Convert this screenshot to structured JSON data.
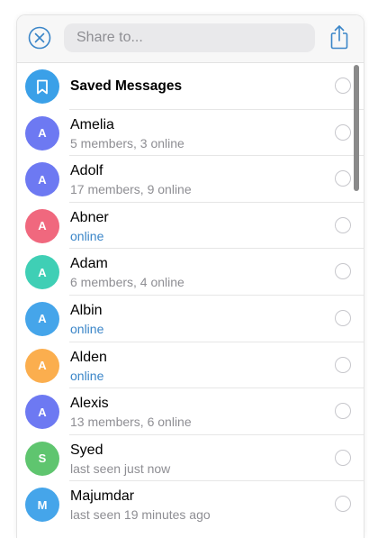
{
  "search": {
    "placeholder": "Share to..."
  },
  "icons": {
    "close": "close-circle-icon",
    "share": "share-icon",
    "saved": "bookmark-icon"
  },
  "colors": {
    "accent": "#3a85c8",
    "online": "#3a85c8"
  },
  "contacts": [
    {
      "name": "Saved Messages",
      "subtitle": "",
      "avatar_letter": "",
      "avatar_color": "#3aa0e8",
      "online": false,
      "saved": true
    },
    {
      "name": "Amelia",
      "subtitle": "5 members, 3 online",
      "avatar_letter": "A",
      "avatar_color": "#6d79f2",
      "online": false
    },
    {
      "name": "Adolf",
      "subtitle": "17 members, 9 online",
      "avatar_letter": "A",
      "avatar_color": "#6d79f2",
      "online": false
    },
    {
      "name": "Abner",
      "subtitle": "online",
      "avatar_letter": "A",
      "avatar_color": "#f0687e",
      "online": true
    },
    {
      "name": "Adam",
      "subtitle": "6 members, 4 online",
      "avatar_letter": "A",
      "avatar_color": "#3fcfb5",
      "online": false
    },
    {
      "name": "Albin",
      "subtitle": "online",
      "avatar_letter": "A",
      "avatar_color": "#45a5ea",
      "online": true
    },
    {
      "name": "Alden",
      "subtitle": "online",
      "avatar_letter": "A",
      "avatar_color": "#fbae4e",
      "online": true
    },
    {
      "name": "Alexis",
      "subtitle": "13 members, 6 online",
      "avatar_letter": "A",
      "avatar_color": "#6d79f2",
      "online": false
    },
    {
      "name": "Syed",
      "subtitle": "last seen just now",
      "avatar_letter": "S",
      "avatar_color": "#5fc56f",
      "online": false
    },
    {
      "name": "Majumdar",
      "subtitle": "last seen 19 minutes ago",
      "avatar_letter": "M",
      "avatar_color": "#45a5ea",
      "online": false
    }
  ]
}
